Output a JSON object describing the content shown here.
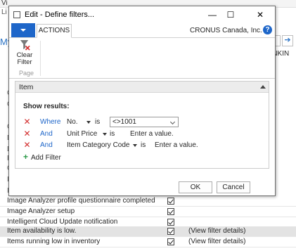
{
  "background": {
    "toolbar_fragments": [
      "Vi",
      "Li"
    ],
    "page_title_fragment": "My",
    "filter_dropdown": "on",
    "user_fragment": "MMANKIN",
    "left_fragments": [
      "C",
      "C",
      "C",
      "D",
      "D",
      "F",
      "G",
      "In",
      "In"
    ],
    "rows": [
      {
        "name": "Image Analyzer profile questionnaire completed",
        "checked": true,
        "detail": ""
      },
      {
        "name": "Image Analyzer setup",
        "checked": true,
        "detail": ""
      },
      {
        "name": "Intelligent Cloud Update notification",
        "checked": true,
        "detail": ""
      },
      {
        "name": "Item availability is low.",
        "checked": true,
        "detail": "(View filter details)",
        "selected": true
      },
      {
        "name": "Items running low in inventory",
        "checked": true,
        "detail": "(View filter details)"
      }
    ]
  },
  "dialog": {
    "title": "Edit - Define filters...",
    "window_buttons": {
      "minimize": "—",
      "maximize": "☐",
      "close": "✕"
    },
    "tab_actions": "ACTIONS",
    "company": "CRONUS Canada, Inc.",
    "help": "?",
    "ribbon": {
      "clear_filter_line1": "Clear",
      "clear_filter_line2": "Filter",
      "group_label": "Page"
    },
    "panel_title": "Item",
    "show_results_label": "Show results:",
    "filters": [
      {
        "operator": "Where",
        "field": "No.",
        "is": "is",
        "value": "<>1001",
        "has_input": true
      },
      {
        "operator": "And",
        "field": "Unit Price",
        "is": "is",
        "value": "Enter a value.",
        "has_input": false
      },
      {
        "operator": "And",
        "field": "Item Category Code",
        "is": "is",
        "value": "Enter a value.",
        "has_input": false
      }
    ],
    "add_filter_label": "Add Filter",
    "ok_label": "OK",
    "cancel_label": "Cancel"
  },
  "colors": {
    "accent": "#1e66c9",
    "remove": "#d32f2f",
    "add": "#2e9b4a"
  }
}
